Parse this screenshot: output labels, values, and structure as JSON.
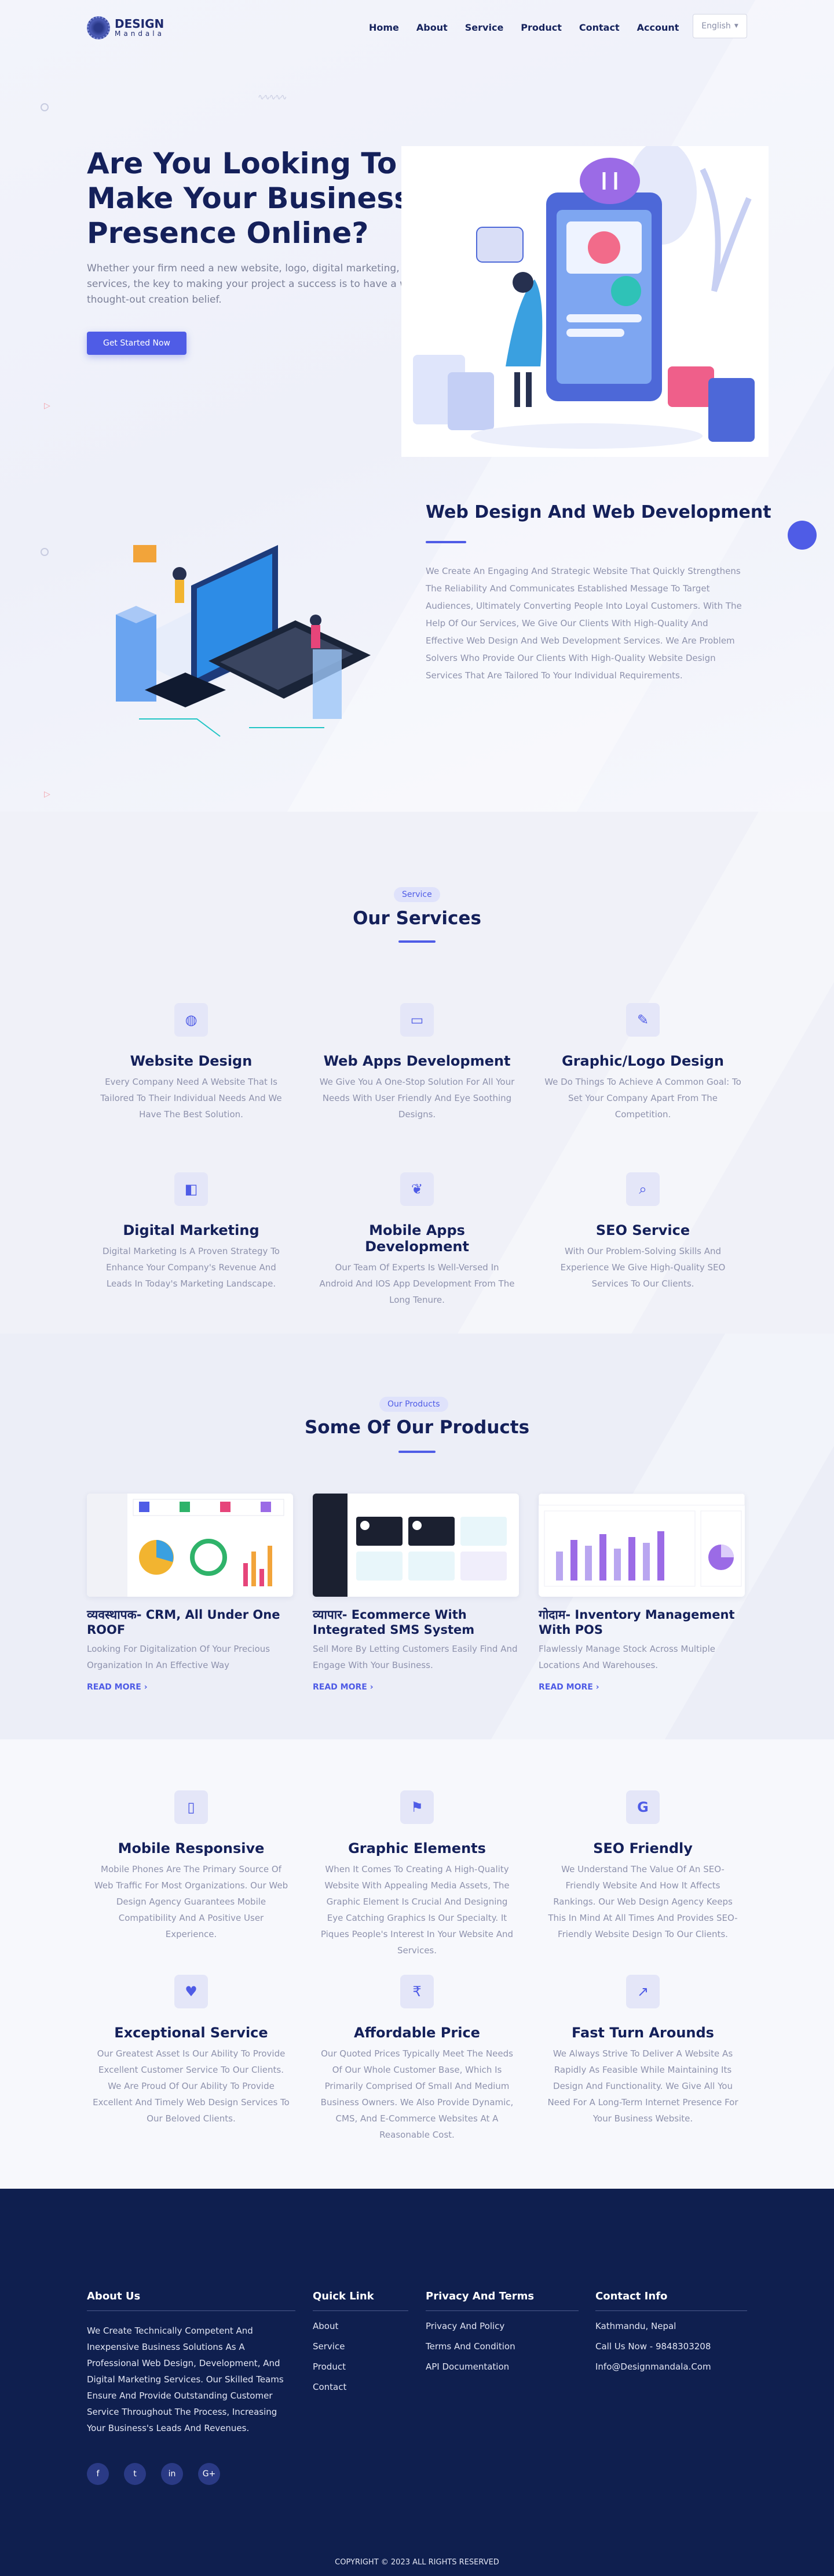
{
  "brand": {
    "name": "DESIGN",
    "tagline": "Mandala"
  },
  "nav": {
    "items": [
      "Home",
      "About",
      "Service",
      "Product",
      "Contact",
      "Account"
    ]
  },
  "language": {
    "selected": "English"
  },
  "hero": {
    "title": "Are You Looking To Make Your Business Presence Online?",
    "subtitle": "Whether your firm need a new website, logo, digital marketing, or SEO services, the key to making your project a success is to have a well thought-out creation belief.",
    "cta": "Get Started Now"
  },
  "webdev": {
    "title": "Web Design And Web Development",
    "text": "We Create An Engaging And Strategic Website That Quickly Strengthens The Reliability And Communicates Established Message To Target Audiences, Ultimately Converting People Into Loyal Customers. With The Help Of Our Services, We Give Our Clients With High-Quality And Effective Web Design And Web Development Services. We Are Problem Solvers Who Provide Our Clients With High-Quality Website Design Services That Are Tailored To Your Individual Requirements."
  },
  "services": {
    "pill": "Service",
    "title": "Our Services",
    "items": [
      {
        "icon": "globe-icon",
        "title": "Website Design",
        "text": "Every Company Need A Website That Is Tailored To Their Individual Needs And We Have The Best Solution."
      },
      {
        "icon": "monitor-icon",
        "title": "Web Apps Development",
        "text": "We Give You A One-Stop Solution For All Your Needs With User Friendly And Eye Soothing Designs."
      },
      {
        "icon": "pen-icon",
        "title": "Graphic/Logo Design",
        "text": "We Do Things To Achieve A Common Goal: To Set Your Company Apart From The Competition."
      },
      {
        "icon": "marketing-icon",
        "title": "Digital Marketing",
        "text": "Digital Marketing Is A Proven Strategy To Enhance Your Company's Revenue And Leads In Today's Marketing Landscape."
      },
      {
        "icon": "apple-icon",
        "title": "Mobile Apps Development",
        "text": "Our Team Of Experts Is Well-Versed In Android And IOS App Development From The Long Tenure."
      },
      {
        "icon": "search-icon",
        "title": "SEO Service",
        "text": "With Our Problem-Solving Skills And Experience We Give High-Quality SEO Services To Our Clients."
      }
    ]
  },
  "products": {
    "pill": "Our Products",
    "title": "Some Of Our Products",
    "more": "READ MORE",
    "items": [
      {
        "title": "व्यवस्थापक- CRM, All Under One ROOF",
        "text": "Looking For Digitalization Of Your Precious Organization In An Effective Way"
      },
      {
        "title": "व्यापार- Ecommerce With Integrated SMS System",
        "text": "Sell More By Letting Customers Easily Find And Engage With Your Business."
      },
      {
        "title": "गोदाम- Inventory Management With POS",
        "text": "Flawlessly Manage Stock Across Multiple Locations And Warehouses."
      }
    ]
  },
  "features": {
    "items": [
      {
        "icon": "mobile-icon",
        "title": "Mobile Responsive",
        "text": "Mobile Phones Are The Primary Source Of Web Traffic For Most Organizations. Our Web Design Agency Guarantees Mobile Compatibility And A Positive User Experience."
      },
      {
        "icon": "paint-brush-icon",
        "title": "Graphic Elements",
        "text": "When It Comes To Creating A High-Quality Website With Appealing Media Assets, The Graphic Element Is Crucial And Designing Eye Catching Graphics Is Our Specialty. It Piques People's Interest In Your Website And Services."
      },
      {
        "icon": "google-icon",
        "title": "SEO Friendly",
        "text": "We Understand The Value Of An SEO-Friendly Website And How It Affects Rankings. Our Web Design Agency Keeps This In Mind At All Times And Provides SEO-Friendly Website Design To Our Clients."
      },
      {
        "icon": "heart-icon",
        "title": "Exceptional Service",
        "text": "Our Greatest Asset Is Our Ability To Provide Excellent Customer Service To Our Clients. We Are Proud Of Our Ability To Provide Excellent And Timely Web Design Services To Our Beloved Clients."
      },
      {
        "icon": "rupee-icon",
        "title": "Affordable Price",
        "text": "Our Quoted Prices Typically Meet The Needs Of Our Whole Customer Base, Which Is Primarily Comprised Of Small And Medium Business Owners. We Also Provide Dynamic, CMS, And E-Commerce Websites At A Reasonable Cost."
      },
      {
        "icon": "chart-icon",
        "title": "Fast Turn Arounds",
        "text": "We Always Strive To Deliver A Website As Rapidly As Feasible While Maintaining Its Design And Functionality. We Give All You Need For A Long-Term Internet Presence For Your Business Website."
      }
    ]
  },
  "footer": {
    "about": {
      "title": "About Us",
      "text": "We Create Technically Competent And Inexpensive Business Solutions As A Professional Web Design, Development, And Digital Marketing Services. Our Skilled Teams Ensure And Provide Outstanding Customer Service Throughout The Process, Increasing Your Business's Leads And Revenues."
    },
    "quick": {
      "title": "Quick Link",
      "links": [
        "About",
        "Service",
        "Product",
        "Contact"
      ]
    },
    "privacy": {
      "title": "Privacy And Terms",
      "links": [
        "Privacy And Policy",
        "Terms And Condition",
        "API Documentation"
      ]
    },
    "contact": {
      "title": "Contact Info",
      "lines": [
        "Kathmandu, Nepal",
        "Call Us Now - 9848303208",
        "Info@Designmandala.Com"
      ]
    },
    "social": [
      "f",
      "t",
      "in",
      "G+"
    ],
    "copyright": "COPYRIGHT © 2023 ALL RIGHTS RESERVED"
  }
}
